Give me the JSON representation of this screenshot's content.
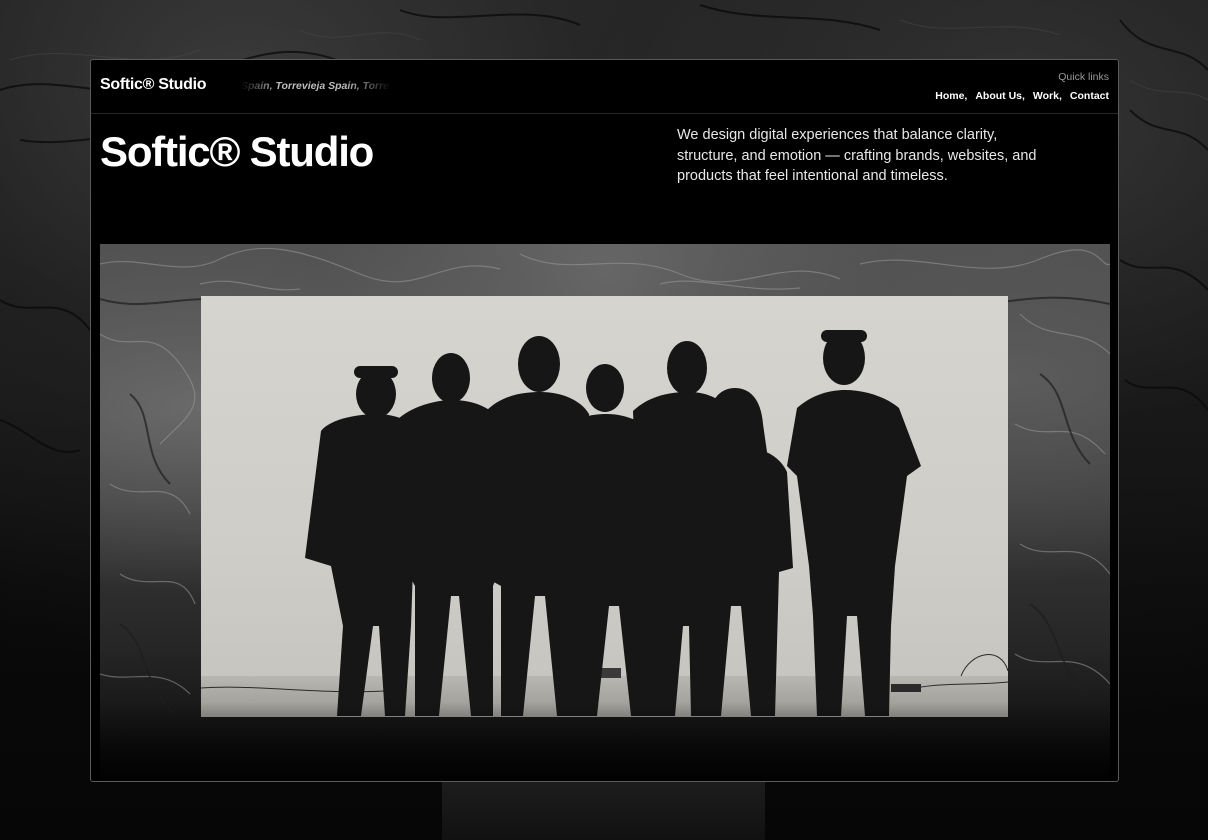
{
  "brand": {
    "name": "Softic® Studio"
  },
  "nav": {
    "ticker_text": "Spain, Torrevieja   Spain, Torrevieja   Spain, Torrevieja",
    "quick_links_label": "Quick links",
    "links": [
      {
        "label": "Home,"
      },
      {
        "label": "About Us,"
      },
      {
        "label": "Work,"
      },
      {
        "label": "Contact"
      }
    ]
  },
  "hero": {
    "title": "Softic® Studio",
    "description": "We design digital experiences that balance clarity, structure, and emotion — crafting brands, websites, and products that feel intentional and timeless."
  },
  "media": {
    "photo_subject": "team-silhouette"
  },
  "colors": {
    "background": "#000000",
    "text": "#ffffff",
    "muted": "#9a9a9a"
  }
}
